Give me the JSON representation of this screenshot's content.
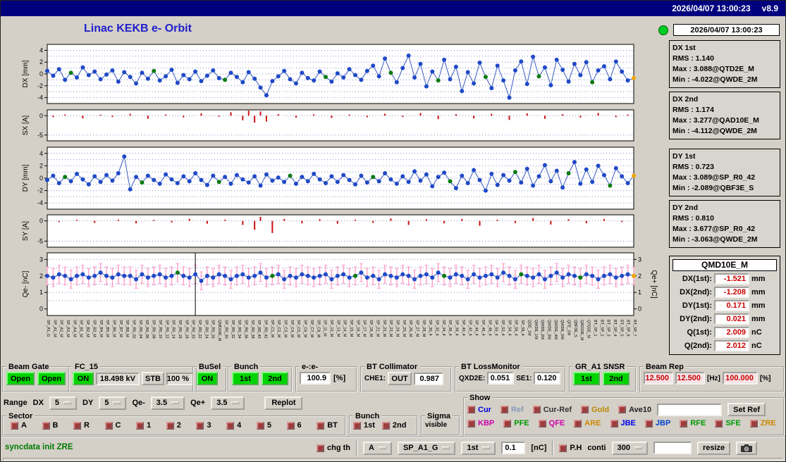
{
  "titlebar": {
    "datetime": "2026/04/07 13:00:23",
    "version": "v8.9"
  },
  "header": {
    "title": "Linac KEKB e- Orbit",
    "timestamp": "2026/04/07 13:00:23"
  },
  "palette": {
    "topbar_navy": "#00007e",
    "title_blue": "#2020cc",
    "led_green": "#00cc22",
    "point_blue": "#1f49c7",
    "point_green": "#0a7c10",
    "point_orange": "#f0a500",
    "line_blue": "#3a5bbf",
    "bar_red": "#cc1111",
    "err_pink": "#ff9ec8",
    "grid": "#8890c8",
    "value_red": "#cc0000",
    "button_green": "#00d400",
    "msg_green": "#007a00"
  },
  "stats": [
    {
      "id": "dx-1st",
      "title": "DX 1st",
      "rows": [
        "RMS : 1.140",
        "Max : 3.088@QTD2E_M",
        "Min : -4.022@QWDE_2M"
      ]
    },
    {
      "id": "dx-2nd",
      "title": "DX 2nd",
      "rows": [
        "RMS : 1.174",
        "Max : 3.277@QAD10E_M",
        "Min : -4.112@QWDE_2M"
      ]
    },
    {
      "id": "dy-1st",
      "title": "DY 1st",
      "rows": [
        "RMS : 0.723",
        "Max : 3.089@SP_R0_42",
        "Min : -2.089@QBF3E_S"
      ]
    },
    {
      "id": "dy-2nd",
      "title": "DY 2nd",
      "rows": [
        "RMS : 0.810",
        "Max : 3.677@SP_R0_42",
        "Min : -3.063@QWDE_2M"
      ]
    }
  ],
  "monitor": {
    "name": "QMD10E_M",
    "rows": [
      {
        "label": "DX(1st):",
        "value": "-1.521",
        "unit": "mm"
      },
      {
        "label": "DX(2nd):",
        "value": "-1.208",
        "unit": "mm"
      },
      {
        "label": "DY(1st):",
        "value": "0.171",
        "unit": "mm"
      },
      {
        "label": "DY(2nd):",
        "value": "0.021",
        "unit": "mm"
      },
      {
        "label": "Q(1st):",
        "value": "2.009",
        "unit": "nC"
      },
      {
        "label": "Q(2nd):",
        "value": "2.012",
        "unit": "nC"
      }
    ]
  },
  "controls": {
    "beam_gate": {
      "legend": "Beam Gate",
      "buttons": [
        "Open",
        "Open"
      ]
    },
    "fc15": {
      "legend": "FC_15",
      "on": "ON",
      "kv": "18.498 kV",
      "stb": "STB",
      "pct": "100 %"
    },
    "busel": {
      "legend": "BuSel",
      "on": "ON"
    },
    "bunch": {
      "legend": "Bunch",
      "buttons": [
        "1st",
        "2nd"
      ]
    },
    "ee": {
      "legend": "e-:e-",
      "value": "100.9",
      "unit": "[%]"
    },
    "bt_collimator": {
      "legend": "BT Collimator",
      "label": "CHE1:",
      "button": "OUT",
      "value": "0.987"
    },
    "bt_lossmonitor": {
      "legend": "BT LossMonitor",
      "items": [
        {
          "label": "QXD2E:",
          "value": "0.051"
        },
        {
          "label": "SE1:",
          "value": "0.120"
        }
      ]
    },
    "gr_snsr": {
      "legend": "GR_A1 SNSR",
      "buttons": [
        "1st",
        "2nd"
      ]
    },
    "beam_rep": {
      "legend": "Beam Rep",
      "values": [
        "12.500",
        "12.500"
      ],
      "hz": "[Hz]",
      "pct": "100.000",
      "pct_unit": "[%]"
    }
  },
  "range_row": {
    "label": "Range",
    "items": [
      {
        "label": "DX",
        "value": "5"
      },
      {
        "label": "DY",
        "value": "5"
      },
      {
        "label": "Qe-",
        "value": "3.5"
      },
      {
        "label": "Qe+",
        "value": "3.5"
      }
    ],
    "replot": "Replot"
  },
  "sector": {
    "legend": "Sector",
    "items": [
      "A",
      "B",
      "R",
      "C",
      "1",
      "2",
      "3",
      "4",
      "5",
      "6",
      "BT"
    ]
  },
  "bunch_sel": {
    "legend": "Bunch",
    "items": [
      "1st",
      "2nd"
    ]
  },
  "sigma": {
    "legend": "Sigma",
    "label": "visible"
  },
  "show": {
    "legend": "Show",
    "row1": [
      {
        "label": "Cur",
        "color": "#0000dd"
      },
      {
        "label": "Ref",
        "color": "#8899bb"
      },
      {
        "label": "Cur-Ref",
        "color": "#333333"
      },
      {
        "label": "Gold",
        "color": "#bb8800"
      },
      {
        "label": "Ave10",
        "color": "#222222"
      }
    ],
    "set_ref": "Set Ref",
    "ref_input": "",
    "row2": [
      {
        "label": "KBP",
        "color": "#cc00aa"
      },
      {
        "label": "PFE",
        "color": "#009900"
      },
      {
        "label": "QFE",
        "color": "#cc00aa"
      },
      {
        "label": "ARE",
        "color": "#cc8800"
      },
      {
        "label": "JBE",
        "color": "#0000ee"
      },
      {
        "label": "JBP",
        "color": "#0044cc"
      },
      {
        "label": "RFE",
        "color": "#009900"
      },
      {
        "label": "SFE",
        "color": "#009900"
      },
      {
        "label": "ZRE",
        "color": "#cc8800"
      }
    ]
  },
  "statusbar": {
    "message": "syncdata init ZRE",
    "chg_th": "chg th",
    "menu_a": "A",
    "menu_sp": "SP_A1_G",
    "menu_bunch": "1st",
    "threshold": "0.1",
    "unit": "[nC]",
    "ph": "P.H",
    "conti": "conti",
    "menu_rep": "300",
    "aux_input": "",
    "resize": "resize"
  },
  "chart_data": [
    {
      "id": "dx",
      "type": "line",
      "title": "DX orbit",
      "ylabel": "DX [mm]",
      "ylim": [
        -5,
        5
      ],
      "yticks": [
        4,
        2,
        0,
        -2,
        -4
      ],
      "grid": [
        -4,
        -3,
        -2,
        -1,
        0,
        1,
        2,
        3,
        4
      ],
      "n": 100,
      "values": [
        0.5,
        -0.3,
        0.8,
        -1.0,
        0.2,
        -0.6,
        1.1,
        -0.2,
        0.4,
        -0.9,
        -0.1,
        0.6,
        -1.3,
        0.3,
        -0.5,
        -1.6,
        0.2,
        -0.8,
        0.5,
        -1.1,
        -0.4,
        0.7,
        -1.5,
        -0.2,
        -0.9,
        0.4,
        -1.2,
        -0.3,
        0.6,
        -0.7,
        -1.0,
        0.2,
        -0.5,
        -1.4,
        0.3,
        -0.8,
        -2.3,
        -3.6,
        -1.2,
        -0.4,
        0.5,
        -0.9,
        -1.6,
        0.2,
        -0.7,
        -1.1,
        0.4,
        -0.5,
        -1.3,
        0.1,
        -0.6,
        0.8,
        -0.2,
        -1.0,
        0.5,
        1.4,
        -0.4,
        2.6,
        0.2,
        -1.4,
        1.0,
        3.1,
        -0.6,
        1.7,
        -2.1,
        0.4,
        -1.1,
        2.4,
        -0.9,
        1.2,
        -2.9,
        0.3,
        -1.6,
        1.9,
        -0.5,
        -2.4,
        1.4,
        -1.1,
        -4.0,
        0.6,
        2.1,
        -1.7,
        2.9,
        -0.4,
        1.1,
        -1.9,
        2.4,
        0.7,
        -1.3,
        1.7,
        -0.2,
        2.0,
        -1.4,
        0.6,
        1.3,
        -0.9,
        2.1,
        0.4,
        -1.1,
        -0.7
      ],
      "green_idx": [
        4,
        18,
        30,
        47,
        58,
        66,
        74,
        83,
        92
      ],
      "orange_idx": [
        99
      ]
    },
    {
      "id": "sx",
      "type": "bar",
      "title": "SX steering",
      "ylabel": "SX [A]",
      "ylim": [
        -6.5,
        1.5
      ],
      "yticks": [
        0,
        -5
      ],
      "grid": [
        0,
        -5
      ],
      "n": 100,
      "bars": [
        [
          1,
          -0.4
        ],
        [
          3,
          0.3
        ],
        [
          6,
          -0.7
        ],
        [
          9,
          0.25
        ],
        [
          11,
          -0.35
        ],
        [
          14,
          0.5
        ],
        [
          17,
          -0.8
        ],
        [
          20,
          0.3
        ],
        [
          23,
          -0.45
        ],
        [
          26,
          0.6
        ],
        [
          29,
          -0.3
        ],
        [
          31,
          0.9
        ],
        [
          33,
          -1.2
        ],
        [
          34,
          1.3
        ],
        [
          35,
          -1.8
        ],
        [
          36,
          1.1
        ],
        [
          37,
          -1.5
        ],
        [
          39,
          0.4
        ],
        [
          42,
          -0.5
        ],
        [
          45,
          0.35
        ],
        [
          48,
          -0.6
        ],
        [
          51,
          0.3
        ],
        [
          54,
          -0.4
        ],
        [
          57,
          0.5
        ],
        [
          60,
          -0.35
        ],
        [
          63,
          0.7
        ],
        [
          66,
          -0.9
        ],
        [
          69,
          0.4
        ],
        [
          72,
          -0.7
        ],
        [
          75,
          0.5
        ],
        [
          78,
          -1.1
        ],
        [
          81,
          0.6
        ],
        [
          84,
          -0.8
        ],
        [
          87,
          0.4
        ],
        [
          90,
          -0.5
        ],
        [
          93,
          0.7
        ],
        [
          96,
          -0.4
        ],
        [
          98,
          0.3
        ]
      ]
    },
    {
      "id": "dy",
      "type": "line",
      "title": "DY orbit",
      "ylabel": "DY [mm]",
      "ylim": [
        -5,
        5
      ],
      "yticks": [
        4,
        2,
        0,
        -2,
        -4
      ],
      "grid": [
        -4,
        -3,
        -2,
        -1,
        0,
        1,
        2,
        3,
        4
      ],
      "n": 100,
      "values": [
        -0.3,
        0.4,
        -0.8,
        0.2,
        -0.5,
        0.7,
        -0.2,
        -1.0,
        0.3,
        -0.6,
        0.5,
        -0.4,
        0.8,
        3.5,
        -1.8,
        0.2,
        -0.7,
        0.4,
        -0.3,
        -0.9,
        0.6,
        -0.2,
        -0.8,
        0.3,
        -0.5,
        0.8,
        -0.3,
        -1.1,
        0.4,
        -0.6,
        0.2,
        -0.9,
        0.5,
        -0.2,
        -0.7,
        0.3,
        -1.2,
        0.6,
        -0.4,
        0.1,
        -0.6,
        0.4,
        -0.9,
        0.2,
        -0.5,
        0.7,
        -0.2,
        -0.8,
        0.3,
        -0.6,
        0.5,
        -0.3,
        -1.0,
        0.4,
        -0.7,
        0.2,
        -0.5,
        0.8,
        -0.2,
        -0.9,
        0.3,
        -0.6,
        1.1,
        -0.4,
        0.6,
        -1.3,
        0.2,
        0.9,
        -0.5,
        -1.6,
        0.4,
        -0.8,
        1.3,
        -0.3,
        -2.0,
        0.7,
        -1.1,
        0.5,
        -0.4,
        1.0,
        -0.7,
        1.5,
        -1.2,
        0.3,
        2.1,
        -0.5,
        1.2,
        -1.5,
        0.8,
        2.6,
        -0.9,
        1.4,
        -0.6,
        2.0,
        0.5,
        -1.2,
        1.6,
        0.3,
        -0.8,
        0.4
      ],
      "green_idx": [
        3,
        16,
        29,
        41,
        55,
        68,
        79,
        88,
        95
      ],
      "orange_idx": [
        99
      ]
    },
    {
      "id": "sy",
      "type": "bar",
      "title": "SY steering",
      "ylabel": "SY [A]",
      "ylim": [
        -6.5,
        1.5
      ],
      "yticks": [
        0,
        -5
      ],
      "grid": [
        0,
        -5
      ],
      "n": 100,
      "bars": [
        [
          2,
          -0.3
        ],
        [
          5,
          0.25
        ],
        [
          8,
          -0.5
        ],
        [
          12,
          0.3
        ],
        [
          15,
          -0.6
        ],
        [
          18,
          0.25
        ],
        [
          21,
          -0.4
        ],
        [
          24,
          0.5
        ],
        [
          27,
          -0.7
        ],
        [
          30,
          0.3
        ],
        [
          33,
          -1.0
        ],
        [
          35,
          -2.2
        ],
        [
          36,
          1.0
        ],
        [
          38,
          -3.0
        ],
        [
          40,
          0.5
        ],
        [
          43,
          -0.6
        ],
        [
          46,
          0.4
        ],
        [
          49,
          -0.7
        ],
        [
          52,
          0.3
        ],
        [
          55,
          -0.5
        ],
        [
          58,
          0.6
        ],
        [
          61,
          -1.0
        ],
        [
          64,
          0.4
        ],
        [
          67,
          -0.6
        ],
        [
          70,
          0.5
        ],
        [
          73,
          -1.2
        ],
        [
          76,
          0.3
        ],
        [
          79,
          -0.55
        ],
        [
          82,
          0.7
        ],
        [
          85,
          -0.9
        ],
        [
          88,
          0.4
        ],
        [
          91,
          -0.6
        ],
        [
          94,
          0.5
        ],
        [
          97,
          -0.3
        ]
      ]
    },
    {
      "id": "qe",
      "type": "line",
      "title": "Charge",
      "ylabel": "Qe- [nC]",
      "ylabel_right": "Qe+ [nC]",
      "right_axis": true,
      "ylim": [
        -0.4,
        3.4
      ],
      "yticks": [
        3,
        2,
        1,
        0
      ],
      "grid": [
        0.5,
        1,
        1.5,
        2,
        2.5,
        3
      ],
      "n": 100,
      "err": 0.55,
      "marker_idx": 25,
      "values": [
        2.0,
        1.9,
        2.1,
        2.0,
        1.8,
        2.0,
        2.1,
        1.9,
        2.0,
        2.2,
        2.0,
        1.9,
        2.1,
        2.0,
        2.0,
        1.8,
        2.1,
        1.9,
        2.0,
        2.1,
        1.9,
        2.0,
        2.2,
        2.0,
        1.9,
        2.1,
        1.7,
        2.0,
        1.9,
        2.1,
        2.0,
        1.8,
        2.0,
        2.1,
        1.9,
        2.0,
        2.2,
        1.9,
        2.0,
        2.1,
        1.8,
        2.0,
        1.9,
        2.1,
        2.0,
        1.9,
        2.0,
        2.1,
        1.8,
        2.0,
        2.1,
        1.9,
        2.0,
        2.2,
        1.9,
        2.0,
        1.8,
        2.1,
        2.0,
        1.9,
        2.1,
        2.0,
        1.8,
        2.0,
        2.1,
        1.9,
        2.2,
        2.0,
        1.9,
        2.1,
        2.0,
        1.8,
        2.1,
        1.9,
        2.0,
        2.1,
        1.9,
        2.2,
        2.0,
        1.8,
        2.1,
        2.0,
        1.9,
        2.1,
        1.8,
        2.0,
        2.2,
        1.9,
        2.1,
        2.0,
        1.9,
        2.1,
        2.0,
        1.8,
        2.0,
        2.1,
        1.9,
        2.0,
        2.1,
        2.0
      ],
      "green_idx": [
        22,
        38,
        52,
        67,
        80,
        90
      ],
      "orange_idx": [
        99
      ]
    },
    {
      "id": "xlabels",
      "type": "axis-labels",
      "names": [
        "SP_A1_G",
        "SP_A1_M",
        "SP_A2_M",
        "SP_A3_M",
        "SP_A4_M",
        "SP_B1_M",
        "SP_B2_M",
        "SP_B3_M",
        "SP_B4_M",
        "SP_B5_M",
        "SP_B6_M",
        "SP_B7_M",
        "SP_B8_M",
        "SP_R0_02",
        "SP_R0_04",
        "SP_R0_06",
        "SP_R0_08",
        "SP_R0_10",
        "SP_R0_12",
        "SP_R0_14",
        "SP_R0_16",
        "SP_R0_18",
        "SP_R0_20",
        "SP_R0_22",
        "SP_R0_24",
        "SP_R0_26",
        "QMD10E_M",
        "SP_R0_30",
        "SP_R0_32",
        "SP_R0_34",
        "SP_R0_36",
        "SP_R0_38",
        "SP_R0_40",
        "SP_R0_42",
        "SP_C1_M",
        "SP_C2_M",
        "SP_C3_M",
        "SP_C4_M",
        "SP_C5_M",
        "SP_C6_M",
        "SP_C7_M",
        "SP_C8_M",
        "SP_11_M",
        "SP_12_M",
        "SP_13_M",
        "SP_14_M",
        "SP_15_M",
        "SP_16_M",
        "SP_17_M",
        "SP_18_M",
        "SP_21_M",
        "SP_22_M",
        "SP_23_M",
        "SP_24_M",
        "SP_25_M",
        "SP_26_M",
        "SP_27_M",
        "SP_28_M",
        "SP_30_4",
        "SP_32_4",
        "SP_34_4",
        "SP_36_4",
        "SP_38_4",
        "SP_40_4",
        "SP_42_4",
        "SP_44_4",
        "SP_46_4",
        "SP_48_4",
        "SP_50_4",
        "SP_52_4",
        "SP_54_4",
        "SP_56_4",
        "SP_58_4",
        "QDE_1M",
        "QWDE_1M",
        "QWDE_2M",
        "QWDE_3M",
        "QWDE_4M",
        "QWDE_5M",
        "QFE_1M",
        "QBF3E_S",
        "QAD10E_M",
        "QTD2E_M",
        "BT_SP_1",
        "BT_SP_2",
        "BT_SP_3",
        "BT_SP_4",
        "BT_SP_5",
        "BT_SP_6",
        "BT_SP_7"
      ]
    }
  ]
}
